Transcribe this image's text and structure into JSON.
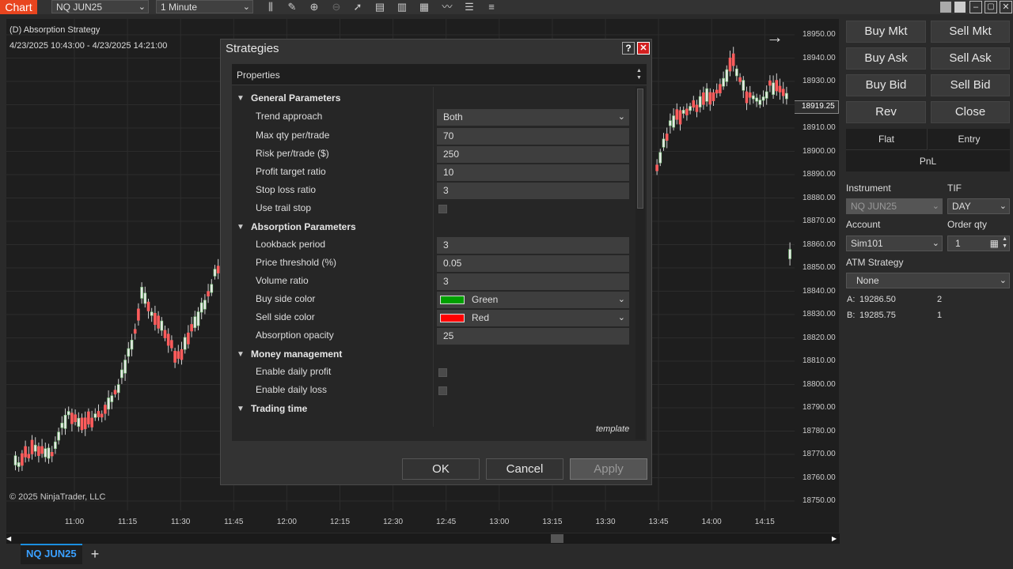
{
  "topbar": {
    "chart_tab": "Chart",
    "instrument": "NQ JUN25",
    "interval": "1 Minute"
  },
  "chart": {
    "strategy_label": "(D) Absorption Strategy",
    "date_range": "4/23/2025 10:43:00 - 4/23/2025 14:21:00",
    "copyright": "© 2025 NinjaTrader, LLC",
    "current_price": "18919.25",
    "price_labels": [
      "18950.00",
      "18940.00",
      "18930.00",
      "18920.00",
      "18910.00",
      "18900.00",
      "18890.00",
      "18880.00",
      "18870.00",
      "18860.00",
      "18850.00",
      "18840.00",
      "18830.00",
      "18820.00",
      "18810.00",
      "18800.00",
      "18790.00",
      "18780.00",
      "18770.00",
      "18760.00",
      "18750.00"
    ],
    "time_labels": [
      "11:00",
      "11:15",
      "11:30",
      "11:45",
      "12:00",
      "12:15",
      "12:30",
      "12:45",
      "13:00",
      "13:15",
      "13:30",
      "13:45",
      "14:00",
      "14:15"
    ],
    "up_color": "#ffffff",
    "down_color": "#ff5c5c",
    "bull_color": "#7fd07f"
  },
  "bottom_tab": {
    "label": "NQ JUN25",
    "add": "+"
  },
  "order_panel": {
    "buy_mkt": "Buy Mkt",
    "sell_mkt": "Sell Mkt",
    "buy_ask": "Buy Ask",
    "sell_ask": "Sell Ask",
    "buy_bid": "Buy Bid",
    "sell_bid": "Sell Bid",
    "rev": "Rev",
    "close": "Close",
    "flat": "Flat",
    "entry": "Entry",
    "pnl": "PnL",
    "instrument_label": "Instrument",
    "instrument_value": "NQ JUN25",
    "tif_label": "TIF",
    "tif_value": "DAY",
    "account_label": "Account",
    "account_value": "Sim101",
    "order_qty_label": "Order qty",
    "order_qty_value": "1",
    "atm_label": "ATM Strategy",
    "atm_value": "None",
    "ask_label": "A:",
    "ask_price": "19286.50",
    "ask_size": "2",
    "bid_label": "B:",
    "bid_price": "19285.75",
    "bid_size": "1"
  },
  "dialog": {
    "title": "Strategies",
    "help": "?",
    "close": "✕",
    "properties": "Properties",
    "general": "General Parameters",
    "trend_approach_label": "Trend approach",
    "trend_approach_value": "Both",
    "max_qty_label": "Max qty per/trade",
    "max_qty_value": "70",
    "risk_label": "Risk per/trade ($)",
    "risk_value": "250",
    "profit_label": "Profit target ratio",
    "profit_value": "10",
    "stop_label": "Stop loss ratio",
    "stop_value": "3",
    "trail_label": "Use trail stop",
    "absorption": "Absorption Parameters",
    "lookback_label": "Lookback period",
    "lookback_value": "3",
    "price_thr_label": "Price threshold (%)",
    "price_thr_value": "0.05",
    "volume_label": "Volume ratio",
    "volume_value": "3",
    "buy_color_label": "Buy side color",
    "buy_color_value": "Green",
    "buy_color_hex": "#00a000",
    "sell_color_label": "Sell side color",
    "sell_color_value": "Red",
    "sell_color_hex": "#ff0000",
    "opacity_label": "Absorption opacity",
    "opacity_value": "25",
    "money": "Money management",
    "daily_profit_label": "Enable daily profit",
    "daily_loss_label": "Enable daily loss",
    "trading_time": "Trading time",
    "template": "template",
    "ok": "OK",
    "cancel": "Cancel",
    "apply": "Apply"
  }
}
